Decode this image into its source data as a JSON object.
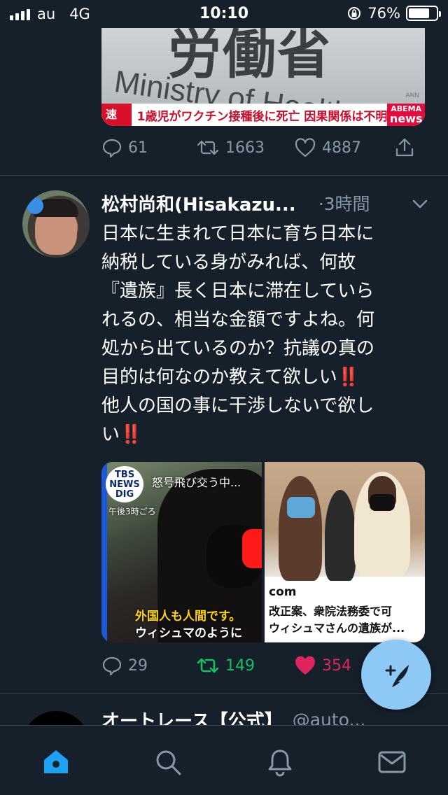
{
  "status_bar": {
    "carrier": "au",
    "network": "4G",
    "time": "10:10",
    "battery": "76%",
    "battery_level": 0.76
  },
  "previous_tweet": {
    "media": {
      "sign_text": "労働省",
      "sign_en": "Ministry of Health",
      "ann": "ANN",
      "ticker_tag": "速報",
      "ticker_text": "1歳児がワクチン接種後に死亡 因果関係は不明",
      "logo_top": "ABEMA",
      "logo_bottom": "news"
    },
    "actions": {
      "replies": "61",
      "retweets": "1663",
      "likes": "4887"
    }
  },
  "tweet": {
    "name": "松村尚和(Hisakazu...",
    "time": "·3時間",
    "body_lines": [
      "日本に生まれて日本に育ち日本に",
      "納税している身がみれば、何故",
      "『遺族』長く日本に滞在していら",
      "れるの、相当な金額ですよね。何",
      "処から出ているのか？抗議の真の",
      "目的は何なのか教えて欲しい",
      "他人の国の事に干渉しないで欲し",
      "い"
    ],
    "emphasis": "‼️",
    "media_left": {
      "logo": "TBS NEWS DIG",
      "caption_top": "怒号飛び交う中...",
      "caption_sub": "午後3時ごろ",
      "caption_1": "外国人も人間です。",
      "caption_2": "ウィシュマのように"
    },
    "media_right": {
      "domain": "com",
      "headline_1": "改正案、衆院法務委で可",
      "headline_2": "ウィシュマさんの遺族が..."
    },
    "actions": {
      "replies": "29",
      "retweets": "149",
      "likes": "354"
    }
  },
  "next_tweet": {
    "name": "オートレース【公式】",
    "handle": "@auto..."
  },
  "tab_bar": {
    "items": [
      "home",
      "search",
      "notifications",
      "messages"
    ]
  },
  "colors": {
    "background": "#15202b",
    "retweeted": "#17bf63",
    "liked": "#e0245e",
    "fab": "#8ec9f6",
    "muted": "#8899a6"
  }
}
